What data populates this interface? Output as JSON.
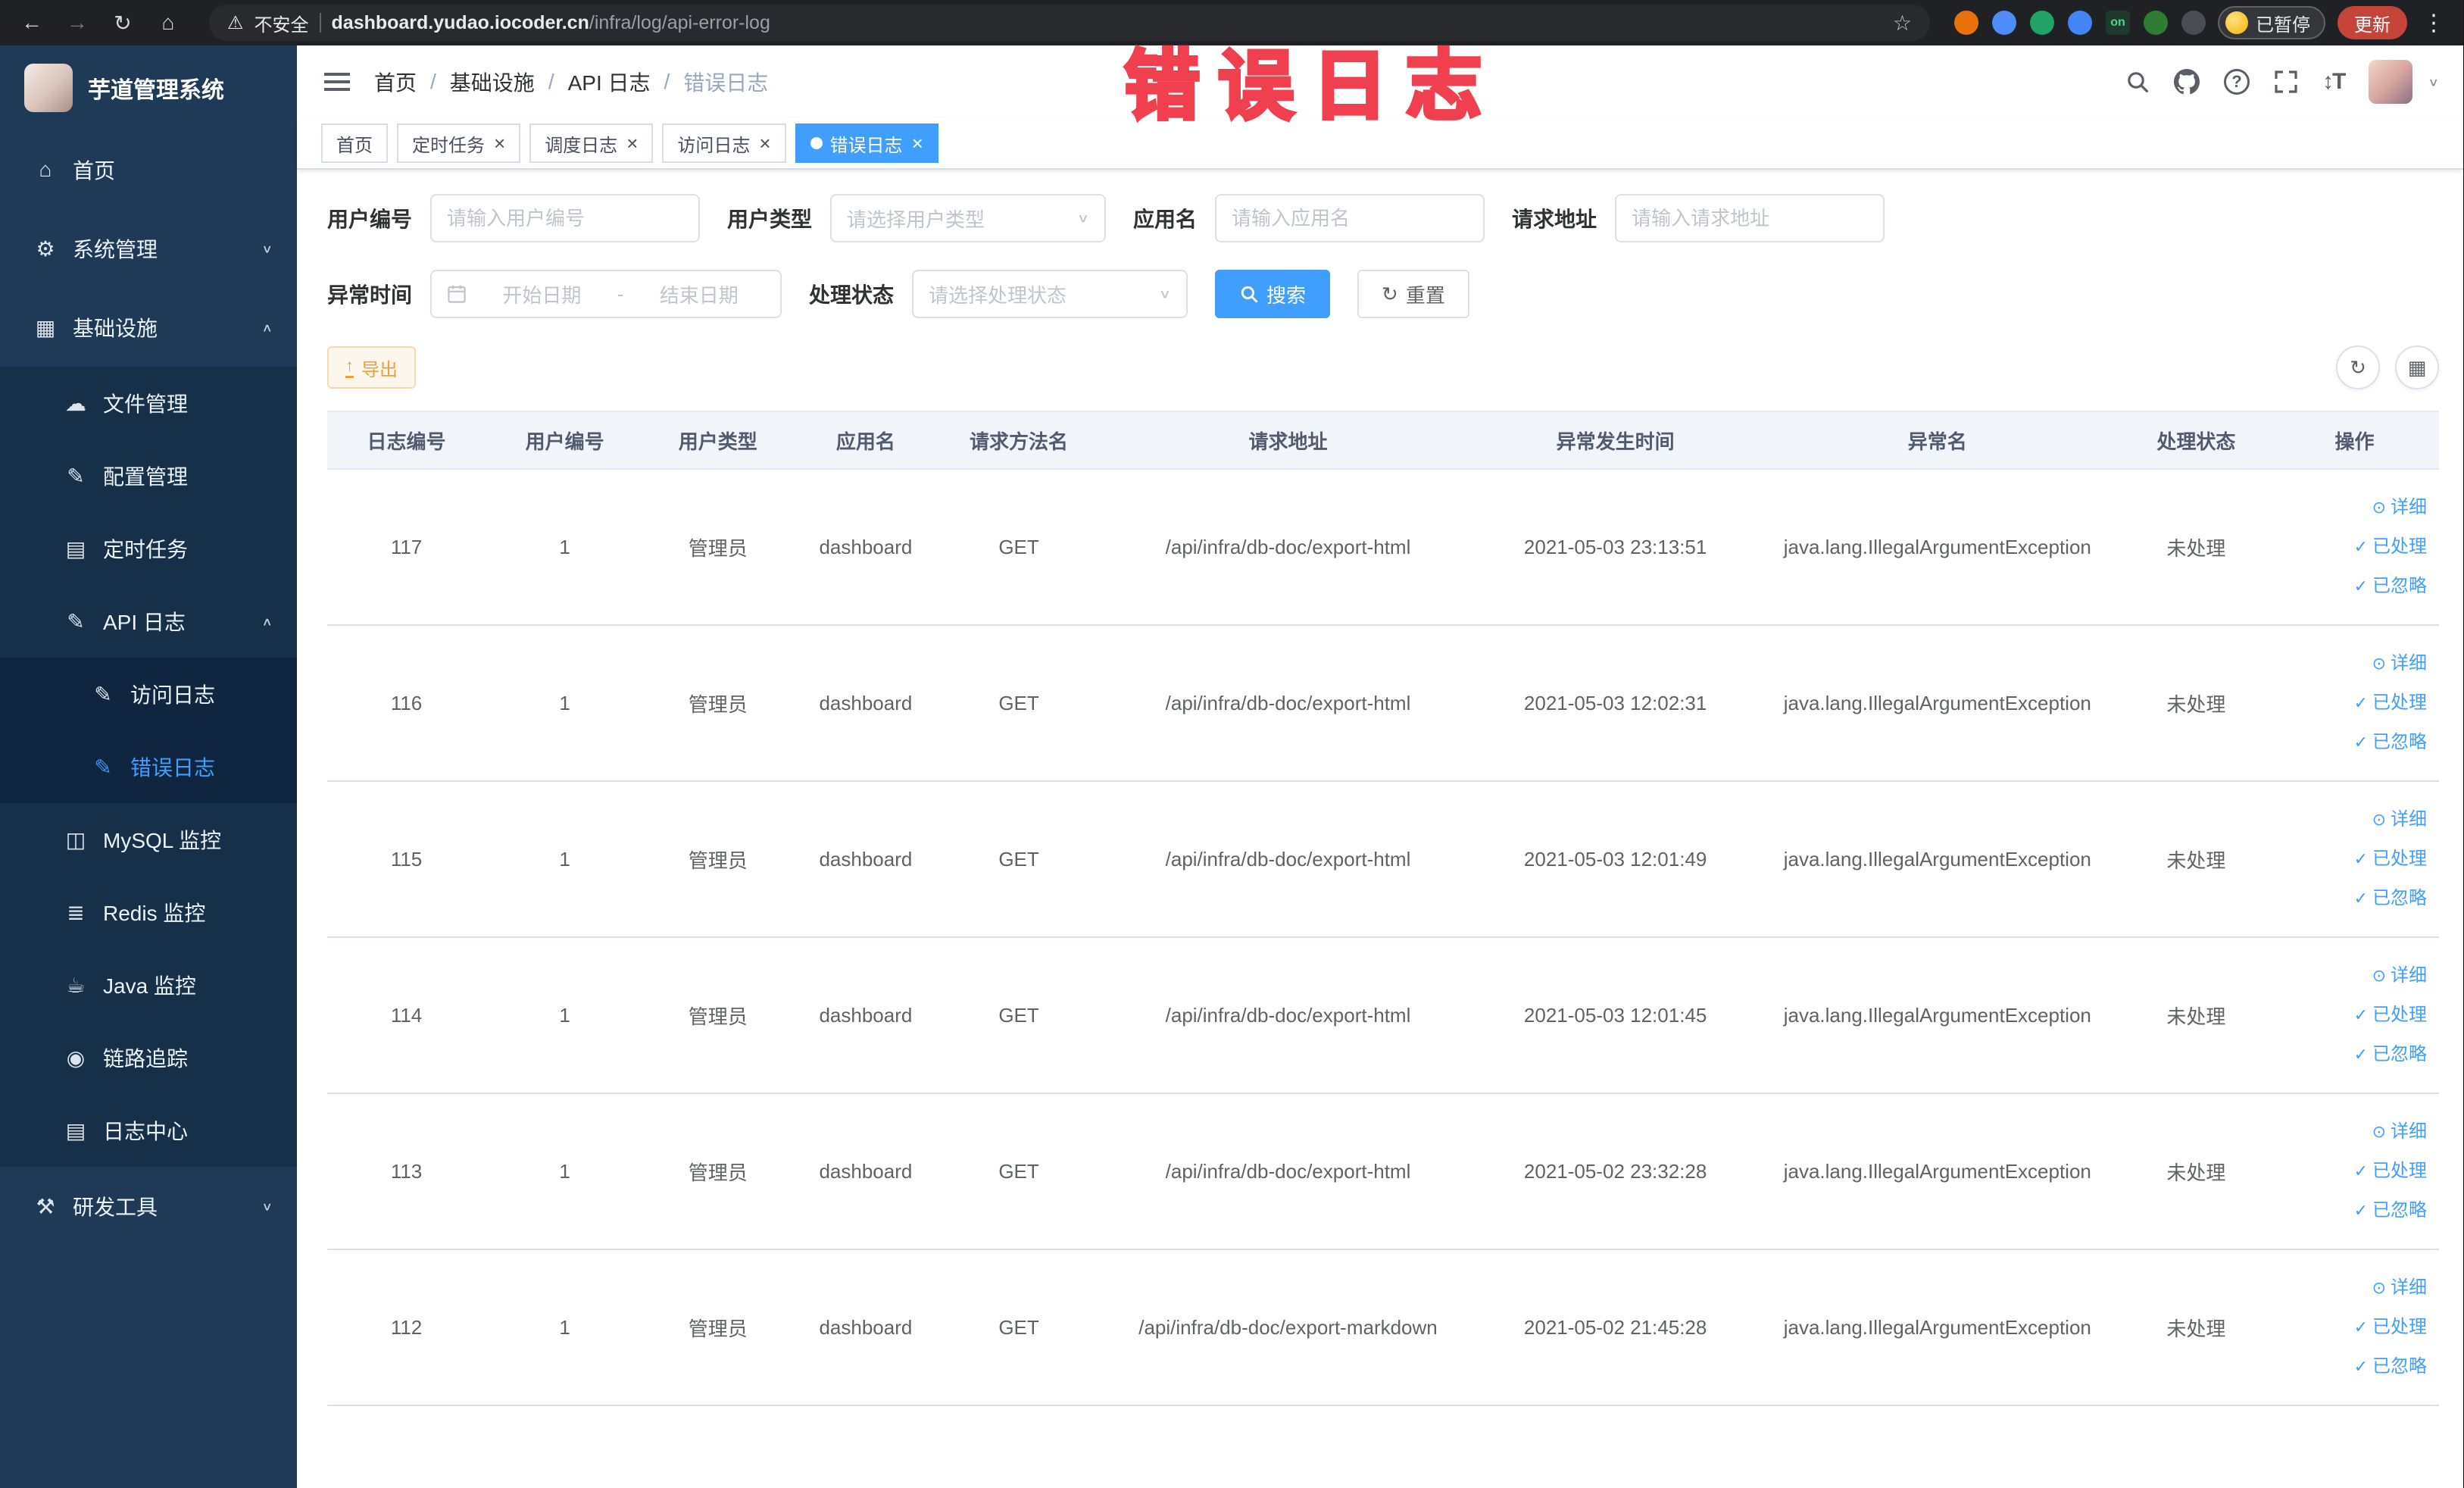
{
  "colors": {
    "accent": "#409eff",
    "sidebar_bg": "#1f3a57",
    "annotation_red": "#f04050",
    "warning_text": "#e6a23c",
    "active_tab_bg": "#409eff"
  },
  "browser": {
    "security_warning": "不安全",
    "url_host": "dashboard.yudao.iocoder.cn",
    "url_path": "/infra/log/api-error-log",
    "paused_badge": "已暂停",
    "update_button": "更新",
    "extensions": [
      {
        "name": "extension-icon-orange",
        "color": "#e8710a"
      },
      {
        "name": "extension-icon-blue-drop",
        "color": "#4e8cf9"
      },
      {
        "name": "extension-icon-green-circle",
        "color": "#21a366"
      },
      {
        "name": "extension-icon-blue-grid",
        "color": "#4285f4"
      },
      {
        "name": "extension-on-badge",
        "color": "#1e3a2f",
        "text": "on",
        "text_color": "#4cd684",
        "shape": "square"
      },
      {
        "name": "extension-icon-leaf",
        "color": "#2e7d32"
      },
      {
        "name": "extension-icon-dark",
        "color": "#4a4d51"
      }
    ]
  },
  "annotation": {
    "text": "错误日志"
  },
  "sidebar": {
    "logo_title": "芋道管理系统",
    "items": [
      {
        "key": "home",
        "label": "首页",
        "icon": "home-icon",
        "level": 1,
        "expandable": false,
        "expanded": false,
        "active": false
      },
      {
        "key": "system",
        "label": "系统管理",
        "icon": "gear-icon",
        "level": 1,
        "expandable": true,
        "expanded": false,
        "active": false
      },
      {
        "key": "infra",
        "label": "基础设施",
        "icon": "grid-icon",
        "level": 1,
        "expandable": true,
        "expanded": true,
        "active": false
      },
      {
        "key": "file",
        "label": "文件管理",
        "icon": "cloud-icon",
        "level": 2,
        "expandable": false,
        "expanded": false,
        "active": false
      },
      {
        "key": "config",
        "label": "配置管理",
        "icon": "edit-icon",
        "level": 2,
        "expandable": false,
        "expanded": false,
        "active": false
      },
      {
        "key": "job",
        "label": "定时任务",
        "icon": "task-icon",
        "level": 2,
        "expandable": false,
        "expanded": false,
        "active": false
      },
      {
        "key": "api-log",
        "label": "API 日志",
        "icon": "log-icon",
        "level": 2,
        "expandable": true,
        "expanded": true,
        "active": false
      },
      {
        "key": "access-log",
        "label": "访问日志",
        "icon": "doc-icon",
        "level": 3,
        "expandable": false,
        "expanded": false,
        "active": false
      },
      {
        "key": "error-log",
        "label": "错误日志",
        "icon": "doc-icon",
        "level": 3,
        "expandable": false,
        "expanded": false,
        "active": true
      },
      {
        "key": "mysql",
        "label": "MySQL 监控",
        "icon": "monitor-icon",
        "level": 2,
        "expandable": false,
        "expanded": false,
        "active": false
      },
      {
        "key": "redis",
        "label": "Redis 监控",
        "icon": "layers-icon",
        "level": 2,
        "expandable": false,
        "expanded": false,
        "active": false
      },
      {
        "key": "java",
        "label": "Java 监控",
        "icon": "java-icon",
        "level": 2,
        "expandable": false,
        "expanded": false,
        "active": false
      },
      {
        "key": "trace",
        "label": "链路追踪",
        "icon": "eye-icon",
        "level": 2,
        "expandable": false,
        "expanded": false,
        "active": false
      },
      {
        "key": "log-center",
        "label": "日志中心",
        "icon": "doc-center-icon",
        "level": 2,
        "expandable": false,
        "expanded": false,
        "active": false
      },
      {
        "key": "dev-tools",
        "label": "研发工具",
        "icon": "tools-icon",
        "level": 1,
        "expandable": true,
        "expanded": false,
        "active": false
      }
    ]
  },
  "icons": {
    "home-icon": "⌂",
    "gear-icon": "⚙",
    "grid-icon": "▦",
    "cloud-icon": "☁",
    "edit-icon": "✎",
    "task-icon": "▤",
    "log-icon": "✎",
    "doc-icon": "✎",
    "monitor-icon": "◫",
    "layers-icon": "≣",
    "java-icon": "☕",
    "eye-icon": "◉",
    "doc-center-icon": "▤",
    "tools-icon": "⚒",
    "chevron-up": "∧",
    "chevron-down": "∨",
    "detail-eye": "⊙",
    "check": "✓",
    "refresh": "↻",
    "close": "×",
    "columns": "▦"
  },
  "breadcrumb": {
    "items": [
      "首页",
      "基础设施",
      "API 日志",
      "错误日志"
    ]
  },
  "tabs": [
    {
      "key": "home",
      "label": "首页",
      "closable": false,
      "active": false
    },
    {
      "key": "job",
      "label": "定时任务",
      "closable": true,
      "active": false
    },
    {
      "key": "job-log",
      "label": "调度日志",
      "closable": true,
      "active": false
    },
    {
      "key": "access-log",
      "label": "访问日志",
      "closable": true,
      "active": false
    },
    {
      "key": "error-log",
      "label": "错误日志",
      "closable": true,
      "active": true
    }
  ],
  "filters": {
    "user_id": {
      "label": "用户编号",
      "placeholder": "请输入用户编号"
    },
    "user_type": {
      "label": "用户类型",
      "placeholder": "请选择用户类型"
    },
    "app_name": {
      "label": "应用名",
      "placeholder": "请输入应用名"
    },
    "request_url": {
      "label": "请求地址",
      "placeholder": "请输入请求地址"
    },
    "exception_time": {
      "label": "异常时间",
      "start_placeholder": "开始日期",
      "separator": "-",
      "end_placeholder": "结束日期"
    },
    "process_status": {
      "label": "处理状态",
      "placeholder": "请选择处理状态"
    },
    "search_button": "搜索",
    "reset_button": "重置"
  },
  "toolbar": {
    "export_button": "导出"
  },
  "table": {
    "columns": [
      "日志编号",
      "用户编号",
      "用户类型",
      "应用名",
      "请求方法名",
      "请求地址",
      "异常发生时间",
      "异常名",
      "处理状态",
      "操作"
    ],
    "row_actions": [
      {
        "key": "detail",
        "label": "详细",
        "icon": "detail-eye"
      },
      {
        "key": "processed",
        "label": "已处理",
        "icon": "check"
      },
      {
        "key": "ignored",
        "label": "已忽略",
        "icon": "check"
      }
    ],
    "rows": [
      {
        "id": "117",
        "user_id": "1",
        "user_type": "管理员",
        "app": "dashboard",
        "method": "GET",
        "url": "/api/infra/db-doc/export-html",
        "time": "2021-05-03 23:13:51",
        "exception": "java.lang.IllegalArgumentException",
        "status": "未处理"
      },
      {
        "id": "116",
        "user_id": "1",
        "user_type": "管理员",
        "app": "dashboard",
        "method": "GET",
        "url": "/api/infra/db-doc/export-html",
        "time": "2021-05-03 12:02:31",
        "exception": "java.lang.IllegalArgumentException",
        "status": "未处理"
      },
      {
        "id": "115",
        "user_id": "1",
        "user_type": "管理员",
        "app": "dashboard",
        "method": "GET",
        "url": "/api/infra/db-doc/export-html",
        "time": "2021-05-03 12:01:49",
        "exception": "java.lang.IllegalArgumentException",
        "status": "未处理"
      },
      {
        "id": "114",
        "user_id": "1",
        "user_type": "管理员",
        "app": "dashboard",
        "method": "GET",
        "url": "/api/infra/db-doc/export-html",
        "time": "2021-05-03 12:01:45",
        "exception": "java.lang.IllegalArgumentException",
        "status": "未处理"
      },
      {
        "id": "113",
        "user_id": "1",
        "user_type": "管理员",
        "app": "dashboard",
        "method": "GET",
        "url": "/api/infra/db-doc/export-html",
        "time": "2021-05-02 23:32:28",
        "exception": "java.lang.IllegalArgumentException",
        "status": "未处理"
      },
      {
        "id": "112",
        "user_id": "1",
        "user_type": "管理员",
        "app": "dashboard",
        "method": "GET",
        "url": "/api/infra/db-doc/export-markdown",
        "time": "2021-05-02 21:45:28",
        "exception": "java.lang.IllegalArgumentException",
        "status": "未处理"
      }
    ]
  }
}
